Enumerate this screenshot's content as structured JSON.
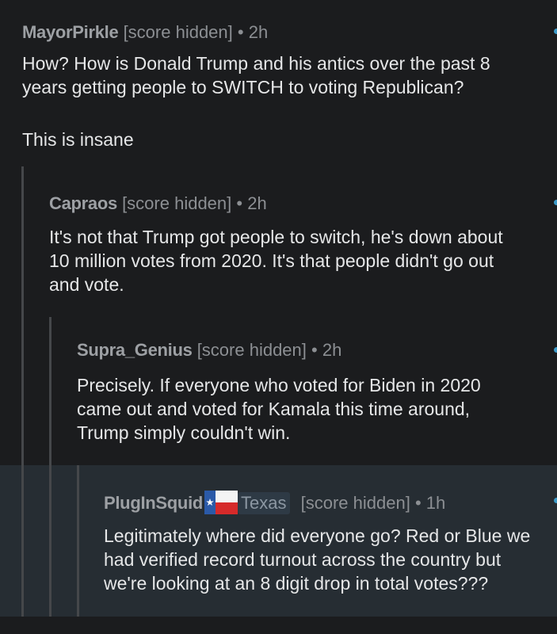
{
  "comments": [
    {
      "author": "MayorPirkle",
      "score": "[score hidden]",
      "separator": "•",
      "age": "2h",
      "lines": [
        "How? How is Donald Trump and his antics over the past 8",
        "years getting people to SWITCH to voting Republican?",
        "",
        "This is insane"
      ]
    },
    {
      "author": "Capraos",
      "score": "[score hidden]",
      "separator": "•",
      "age": "2h",
      "lines": [
        "It's not that Trump got people to switch, he's down about",
        "10 million votes from 2020. It's that people didn't go out",
        "and vote."
      ]
    },
    {
      "author": "Supra_Genius",
      "score": "[score hidden]",
      "separator": "•",
      "age": "2h",
      "lines": [
        "Precisely. If everyone who voted for Biden in 2020",
        "came out and voted for Kamala this time around,",
        "Trump simply couldn't win."
      ]
    },
    {
      "author": "PlugInSquid",
      "flair": "Texas",
      "flair_icon": "texas-flag-icon",
      "score": "[score hidden]",
      "separator": "•",
      "age": "1h",
      "lines": [
        "Legitimately where did everyone go? Red or Blue we",
        "had verified record turnout across the country but",
        "we're looking at an 8 digit drop in total votes???"
      ]
    }
  ],
  "colors": {
    "background": "#1b1c1e",
    "highlighted_background": "#262d33",
    "thread_line": "#45474a",
    "new_indicator": "#3b9ac9",
    "body_text": "#e6e7e8",
    "meta_text": "#8c8f93"
  }
}
